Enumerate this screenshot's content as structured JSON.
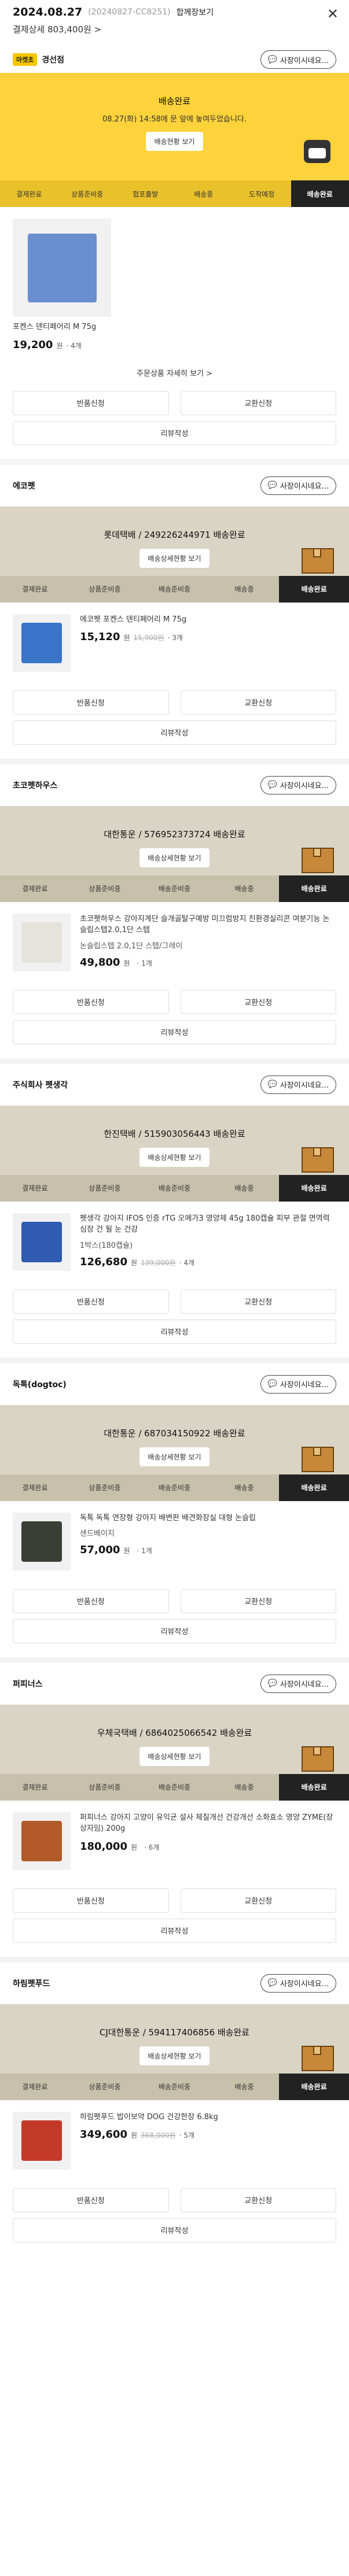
{
  "header": {
    "date": "2024.08.27",
    "order_code": "(20240827-CC8251)",
    "merge_label": "합께장보기",
    "total_label": "결제상세 803,400원",
    "total_arrow": ">"
  },
  "ask_label": "사장이시네요...",
  "first_store": {
    "badge": "마켓초",
    "name": "경선점",
    "banner": {
      "title": "배송완료",
      "subtitle": "08.27(화) 14:58에 문 앞에 놓여두었습니다.",
      "track_label": "배송현황 보기"
    }
  },
  "steps": [
    "결제완료",
    "상품준비중",
    "협포출발",
    "배송중",
    "도착예정",
    "배송완료"
  ],
  "steps_std": [
    "결제완료",
    "상품준비중",
    "배송준비중",
    "배송중",
    "배송완료"
  ],
  "products_first": [
    {
      "name": "포켄스 덴티페어리 M 75g",
      "price": "19,200",
      "won": "원",
      "qty": "· 4개"
    }
  ],
  "detail_link": "주문상품 자세히 보기 >",
  "actions": {
    "return": "반품신청",
    "exchange": "교환신청",
    "review": "리뷰작성"
  },
  "track_label_std": "배송상세현황 보기",
  "sections": [
    {
      "seller": "에코펫",
      "delivery": "롯데택배 / 249226244971 배송완료",
      "product": {
        "name": "에코펫 포켄스 덴티페어리 M 75g",
        "name_bold": "에코펫",
        "opt": "",
        "price": "15,120",
        "orig": "15,900원",
        "qty": "· 3개"
      }
    },
    {
      "seller": "초코펫하우스",
      "delivery": "대한통운 / 576952373724 배송완료",
      "product": {
        "name": "초코펫하우스 강아지계단 슬개골탈구예방 미끄럼방지 친환경실리콘 여분기능 논슬립스텝2.0,1단 스텝",
        "name_bold": "초코펫하우스",
        "opt": "논슬립스텝 2.0,1단 스텝/그레이",
        "price": "49,800",
        "orig": "",
        "qty": "· 1개"
      }
    },
    {
      "seller": "주식회사 펫생각",
      "delivery": "한진택배 / 515903056443 배송완료",
      "product": {
        "name": "펫생각 강아지 IFOS 인증 rTG 오메가3 영양제 45g 180캡슐 피부 관절 면역력 심장 건 될 눈 건강",
        "name_bold": "펫생각",
        "opt": "1박스(180캡슐)",
        "price": "126,680",
        "orig": "139,000원",
        "qty": "· 4개"
      }
    },
    {
      "seller": "독톡(dogtoc)",
      "delivery": "대한통운 / 687034150922 배송완료",
      "product": {
        "name": "독톡 독톡 연장형 강아지 배변판 배견화장실 대형 논슬립",
        "name_bold": "독톡",
        "opt": "샌드베이지",
        "price": "57,000",
        "orig": "",
        "qty": "· 1개"
      }
    },
    {
      "seller": "퍼피너스",
      "delivery": "우체국택배 / 6864025066542 배송완료",
      "product": {
        "name": "퍼피너스 강아지 고양이 유익균 설사 체질개선 건강개선 소화효소 영양 ZYME(장상자임) 200g",
        "name_bold": "",
        "opt": "",
        "price": "180,000",
        "orig": "",
        "qty": "· 6개"
      }
    },
    {
      "seller": "하림펫푸드",
      "delivery": "CJ대한통운 / 594117406856 배송완료",
      "product": {
        "name": "하림펫푸드 밥이보약 DOG 건강한장 6.8kg",
        "name_bold": "하림펫푸드",
        "opt": "",
        "price": "349,600",
        "orig": "368,000원",
        "qty": "· 5개"
      }
    }
  ],
  "colors": {
    "yellow": "#fdd23a",
    "gray_banner": "#d9d4c4",
    "active_step": "#222222"
  },
  "icons": [
    "close-icon",
    "chat-icon",
    "chevron-right-icon",
    "delivery-box-icon"
  ]
}
